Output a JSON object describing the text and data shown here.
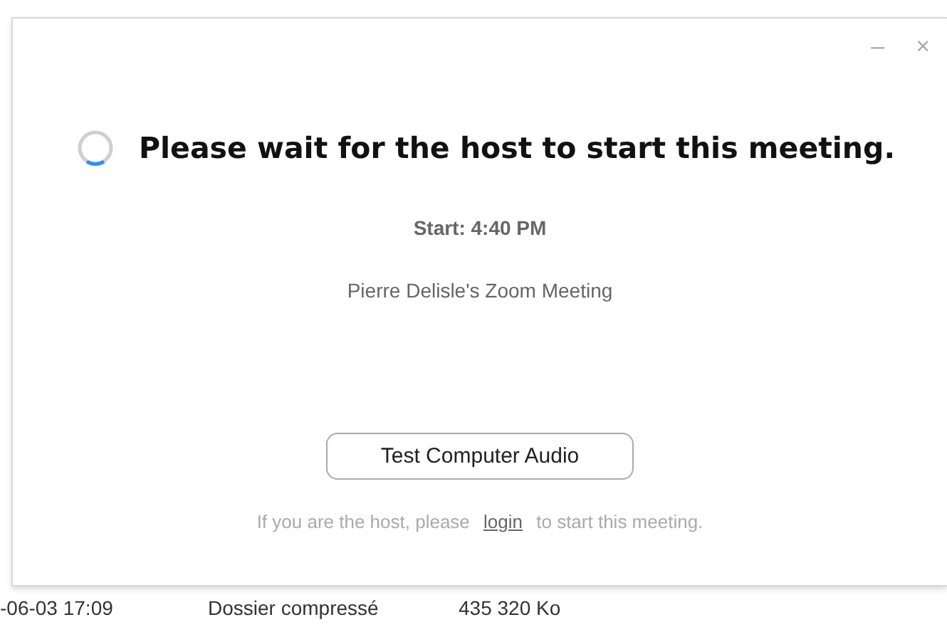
{
  "dialog": {
    "controls": [
      "–",
      "×"
    ],
    "message": "Please wait for the host to start this meeting.",
    "start": "Start: 4:40 PM",
    "meeting_name": "Pierre Delisle's Zoom Meeting",
    "button": "Test Computer Audio",
    "hint": {
      "before": "If you are the host, please",
      "link": "login",
      "after": "to start this meeting."
    }
  },
  "background_row": {
    "date": "-06-03 17:09",
    "type": "Dossier compressé",
    "size": "435 320 Ko"
  }
}
